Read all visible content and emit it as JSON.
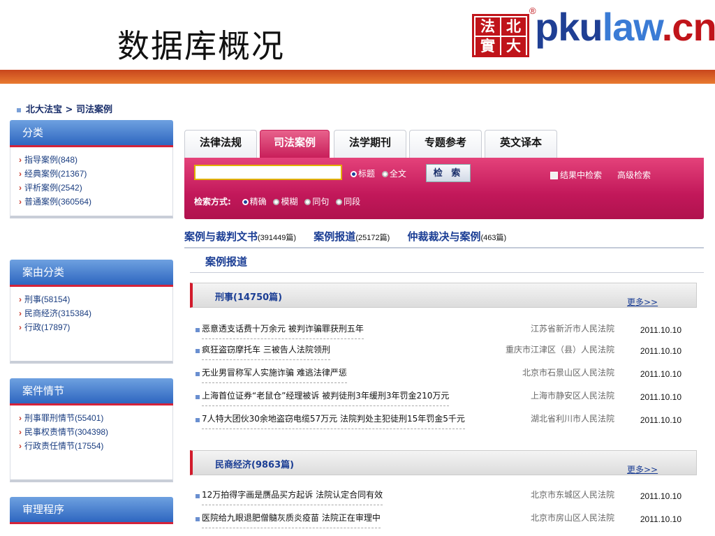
{
  "slide_title": "数据库概况",
  "logo": {
    "seal": [
      "法",
      "北",
      "實",
      "大"
    ],
    "brand_a": "pku",
    "brand_b": "law",
    "brand_c": ".cn",
    "reg_mark": "®"
  },
  "breadcrumb": "北大法宝 > 司法案例",
  "sidebar": {
    "panels": [
      {
        "title": "分类",
        "items": [
          "指导案例(848)",
          "经典案例(21367)",
          "评析案例(2542)",
          "普通案例(360564)"
        ]
      },
      {
        "title": "案由分类",
        "items": [
          "刑事(58154)",
          "民商经济(315384)",
          "行政(17897)"
        ]
      },
      {
        "title": "案件情节",
        "items": [
          "刑事罪刑情节(55401)",
          "民事权责情节(304398)",
          "行政责任情节(17554)"
        ]
      },
      {
        "title": "审理程序",
        "items": []
      }
    ]
  },
  "tabs": [
    "法律法规",
    "司法案例",
    "法学期刊",
    "专题参考",
    "英文译本"
  ],
  "active_tab": 1,
  "search": {
    "scope_title": "标题",
    "scope_full": "全文",
    "button": "检 索",
    "in_results": "结果中检索",
    "advanced": "高级检索",
    "mode_label": "检索方式:",
    "modes": [
      "精确",
      "模糊",
      "同句",
      "同段"
    ]
  },
  "categories": [
    {
      "name": "案例与裁判文书",
      "count": "(391449篇)"
    },
    {
      "name": "案例报道",
      "count": "(25172篇)"
    },
    {
      "name": "仲裁裁决与案例",
      "count": "(463篇)"
    }
  ],
  "section_title": "案例报道",
  "groups": [
    {
      "title": "刑事(14750篇)",
      "more": "更多>>",
      "rows": [
        {
          "title": "恶意透支话费十万余元 被判诈骗罪获刑五年",
          "court": "江苏省新沂市人民法院",
          "date": "2011.10.10"
        },
        {
          "title": "疯狂盗窃摩托车 三被告人法院领刑",
          "court": "重庆市江津区（县）人民法院",
          "date": "2011.10.10"
        },
        {
          "title": "无业男冒称军人实施诈骗 难逃法律严惩",
          "court": "北京市石景山区人民法院",
          "date": "2011.10.10"
        },
        {
          "title": "上海首位证券“老鼠仓”经理被诉 被判徒刑3年缓刑3年罚金210万元",
          "court": "上海市静安区人民法院",
          "date": "2011.10.10"
        },
        {
          "title": "7人特大团伙30余地盗窃电缆57万元 法院判处主犯徒刑15年罚金5千元",
          "court": "湖北省利川市人民法院",
          "date": "2011.10.10"
        }
      ]
    },
    {
      "title": "民商经济(9863篇)",
      "more": "更多>>",
      "rows": [
        {
          "title": "12万拍得字画是赝品买方起诉 法院认定合同有效",
          "court": "北京市东城区人民法院",
          "date": "2011.10.10"
        },
        {
          "title": "医院给九眼退肥僧髓灰质炎疫苗 法院正在审理中",
          "court": "北京市房山区人民法院",
          "date": "2011.10.10"
        }
      ]
    }
  ]
}
